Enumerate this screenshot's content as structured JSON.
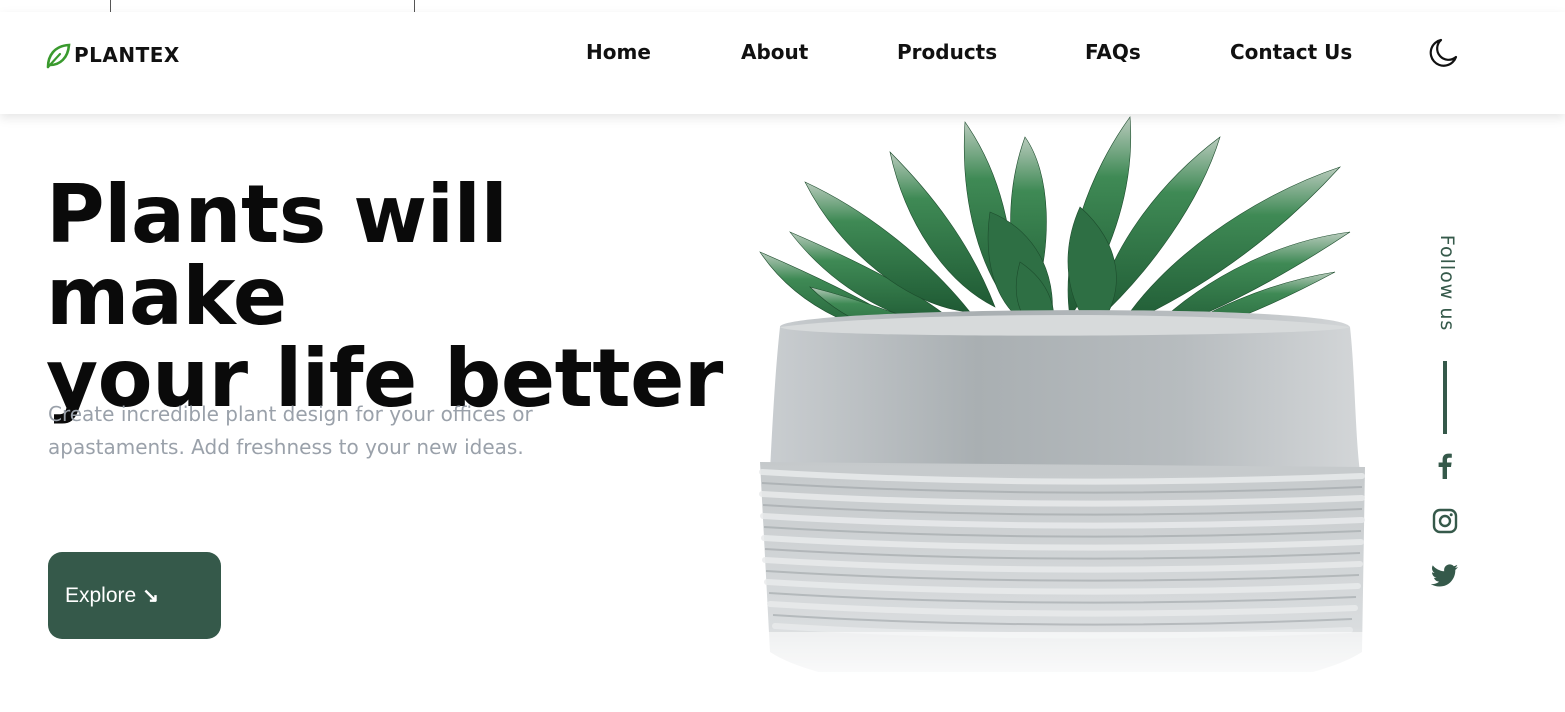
{
  "brand": {
    "name": "PLANTEX",
    "accent": "#35594a",
    "leaf_color": "#3a9a2e"
  },
  "nav": {
    "items": [
      "Home",
      "About",
      "Products",
      "FAQs",
      "Contact Us"
    ],
    "theme_toggle_icon": "moon-icon"
  },
  "hero": {
    "title_line1": "Plants will make",
    "title_line2": "your life better",
    "description": "Create incredible plant design for your offices or apastaments. Add freshness to your new ideas.",
    "cta_label": "Explore",
    "cta_icon": "arrow-down-right-icon"
  },
  "social": {
    "follow_label": "Follow us",
    "icons": [
      "facebook-icon",
      "instagram-icon",
      "twitter-icon"
    ]
  }
}
